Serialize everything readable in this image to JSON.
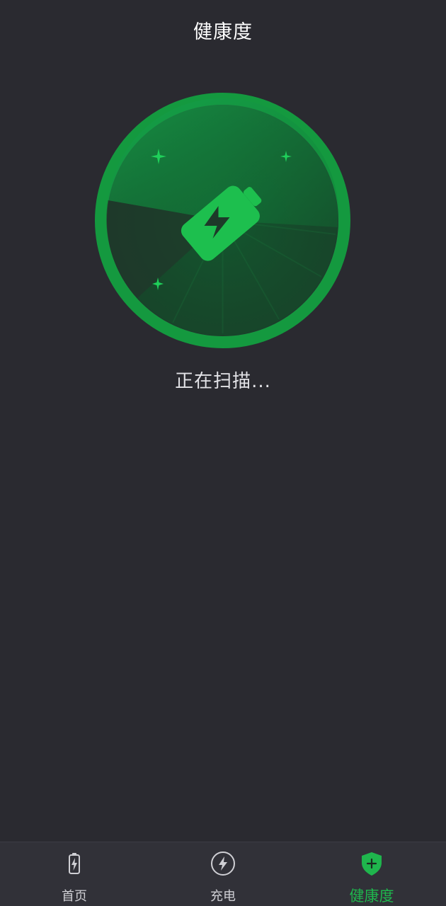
{
  "header": {
    "title": "健康度"
  },
  "scan": {
    "status_text": "正在扫描...",
    "icon": "battery-charging-icon",
    "accent_color": "#1aa145"
  },
  "tabbar": {
    "active_color": "#1fb54d",
    "inactive_color": "#cfcfd4",
    "tabs": [
      {
        "label": "首页",
        "icon": "battery-icon",
        "active": false
      },
      {
        "label": "充电",
        "icon": "lightning-circle-icon",
        "active": false
      },
      {
        "label": "健康度",
        "icon": "shield-plus-icon",
        "active": true
      }
    ]
  }
}
